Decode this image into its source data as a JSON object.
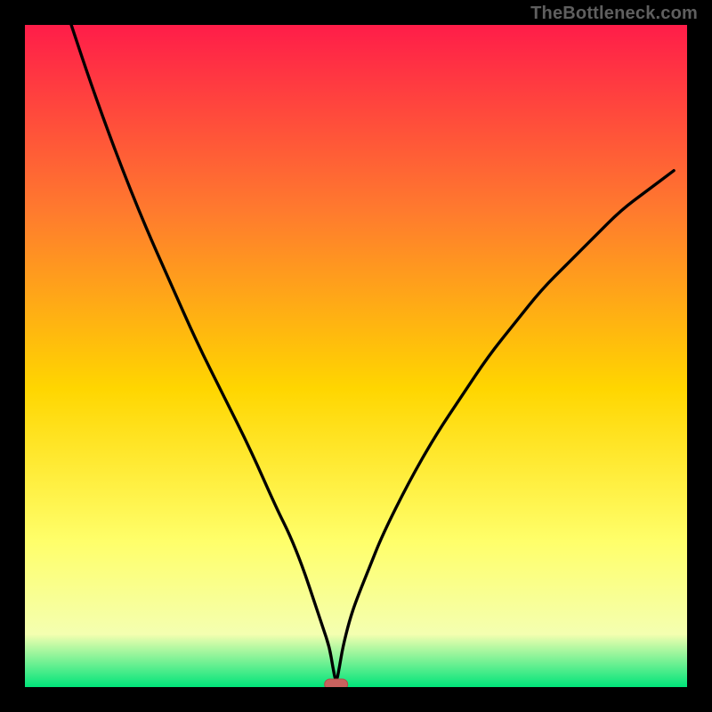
{
  "watermark": "TheBottleneck.com",
  "colors": {
    "gradient_top": "#ff1d49",
    "gradient_upper_mid": "#ff7a2e",
    "gradient_mid": "#ffd600",
    "gradient_lower_mid": "#ffff6a",
    "gradient_near_bottom": "#f4ffb0",
    "gradient_bottom": "#00e47a",
    "curve": "#000000",
    "marker_fill": "#c9615e",
    "marker_stroke": "#b44b48",
    "frame": "#000000"
  },
  "chart_data": {
    "type": "line",
    "title": "",
    "xlabel": "",
    "ylabel": "",
    "xlim": [
      0,
      100
    ],
    "ylim": [
      0,
      100
    ],
    "grid": false,
    "legend": false,
    "minimum_x": 47,
    "marker": {
      "x": 47,
      "y": 0,
      "shape": "rounded-rect"
    },
    "series": [
      {
        "name": "curve",
        "x": [
          7,
          10,
          14,
          18,
          22,
          26,
          30,
          34,
          38,
          40,
          42,
          44,
          45,
          46,
          46.5,
          47,
          47.5,
          48,
          49,
          50,
          52,
          54,
          58,
          62,
          66,
          70,
          74,
          78,
          82,
          86,
          90,
          94,
          98
        ],
        "y": [
          100,
          91,
          80,
          70,
          61,
          52,
          44,
          36,
          27,
          23,
          18,
          12,
          9,
          6,
          3,
          0.5,
          3,
          6,
          10,
          13,
          18,
          23,
          31,
          38,
          44,
          50,
          55,
          60,
          64,
          68,
          72,
          75,
          78
        ]
      }
    ]
  }
}
